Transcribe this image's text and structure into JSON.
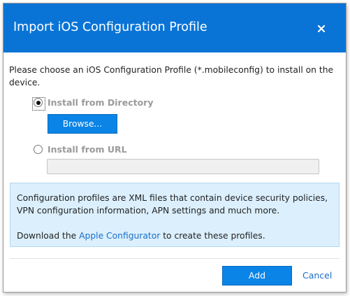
{
  "dialog": {
    "title": "Import iOS Configuration Profile",
    "close_icon": "close-icon"
  },
  "intro_text": "Please choose an iOS Configuration Profile (*.mobileconfig) to install on the device.",
  "options": {
    "directory": {
      "label": "Install from Directory",
      "selected": true
    },
    "browse_label": "Browse...",
    "url": {
      "label": "Install from URL",
      "selected": false,
      "input_value": ""
    }
  },
  "info": {
    "text": "Configuration profiles are XML files that contain device security policies, VPN configuration information, APN settings and much more.",
    "download_prefix": "Download the ",
    "download_link": "Apple Configurator",
    "download_suffix": " to create these profiles."
  },
  "footer": {
    "add_label": "Add",
    "cancel_label": "Cancel"
  },
  "colors": {
    "accent": "#0a74d6",
    "button": "#0a84e6",
    "link": "#1a6fc7",
    "info_bg": "#dbeffd"
  }
}
